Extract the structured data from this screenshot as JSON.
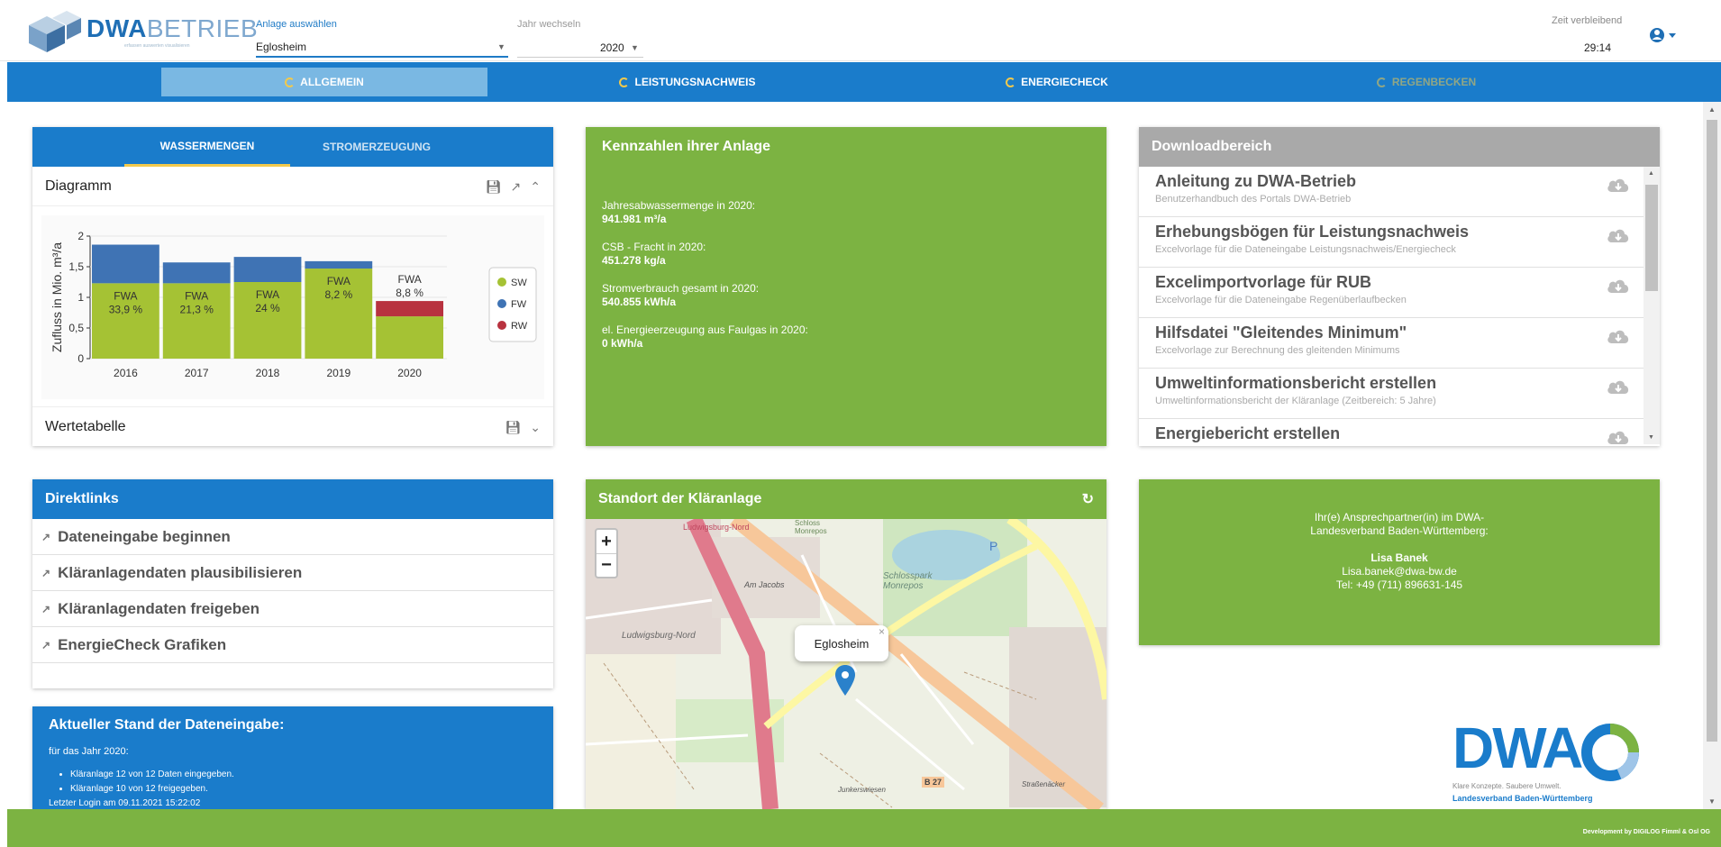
{
  "header": {
    "logo_bold": "DWA",
    "logo_light": "BETRIEB",
    "logo_sub": "erfassen  auswerten  visualisieren",
    "anlage_label": "Anlage auswählen",
    "anlage_value": "Eglosheim",
    "jahr_label": "Jahr wechseln",
    "jahr_value": "2020",
    "zeit_label": "Zeit verbleibend",
    "zeit_value": "29:14"
  },
  "nav": [
    {
      "label": "ALLGEMEIN",
      "state": "active"
    },
    {
      "label": "LEISTUNGSNACHWEIS",
      "state": "normal"
    },
    {
      "label": "ENERGIECHECK",
      "state": "normal"
    },
    {
      "label": "REGENBECKEN",
      "state": "disabled"
    }
  ],
  "wasser": {
    "tab1": "WASSERMENGEN",
    "tab2": "STROMERZEUGUNG",
    "diagramm_title": "Diagramm",
    "werte_title": "Wertetabelle"
  },
  "chart_data": {
    "type": "bar",
    "stacked": true,
    "categories": [
      "2016",
      "2017",
      "2018",
      "2019",
      "2020"
    ],
    "ylabel": "Zufluss in Mio. m³/a",
    "ylim": [
      0,
      2
    ],
    "yticks": [
      "0",
      "0,5",
      "1",
      "1,5",
      "2"
    ],
    "series": [
      {
        "name": "SW",
        "color": "#a5c234",
        "values": [
          1.23,
          1.23,
          1.25,
          1.47,
          0.69
        ]
      },
      {
        "name": "FW",
        "color": "#3f73b4",
        "values": [
          0.63,
          0.34,
          0.41,
          0.12,
          0.0
        ]
      },
      {
        "name": "RW",
        "color": "#b8323f",
        "values": [
          0.0,
          0.0,
          0.0,
          0.0,
          0.25
        ]
      }
    ],
    "annotations": [
      {
        "line1": "FWA",
        "line2": "33,9 %"
      },
      {
        "line1": "FWA",
        "line2": "21,3 %"
      },
      {
        "line1": "FWA",
        "line2": "24 %"
      },
      {
        "line1": "FWA",
        "line2": "8,2 %"
      },
      {
        "line1": "FWA",
        "line2": "8,8 %"
      }
    ],
    "legend_position": "right"
  },
  "kennzahlen": {
    "title": "Kennzahlen ihrer Anlage",
    "items": [
      {
        "label": "Jahresabwassermenge in 2020:",
        "value": "941.981 m³/a"
      },
      {
        "label": "CSB - Fracht in 2020:",
        "value": "451.278 kg/a"
      },
      {
        "label": "Stromverbrauch gesamt in 2020:",
        "value": "540.855 kWh/a"
      },
      {
        "label": "el. Energieerzeugung aus Faulgas in 2020:",
        "value": "0 kWh/a"
      }
    ]
  },
  "downloads": {
    "title": "Downloadbereich",
    "items": [
      {
        "title": "Anleitung zu DWA-Betrieb",
        "sub": "Benutzerhandbuch des Portals DWA-Betrieb"
      },
      {
        "title": "Erhebungsbögen für Leistungsnachweis",
        "sub": "Excelvorlage für die Dateneingabe Leistungsnachweis/Energiecheck"
      },
      {
        "title": "Excelimportvorlage für RUB",
        "sub": "Excelvorlage für die Dateneingabe Regenüberlaufbecken"
      },
      {
        "title": "Hilfsdatei \"Gleitendes Minimum\"",
        "sub": "Excelvorlage zur Berechnung des gleitenden Minimums"
      },
      {
        "title": "Umweltinformationsbericht erstellen",
        "sub": "Umweltinformationsbericht der Kläranlage (Zeitbereich: 5 Jahre)"
      },
      {
        "title": "Energiebericht erstellen",
        "sub": ""
      }
    ]
  },
  "direktlinks": {
    "title": "Direktlinks",
    "items": [
      "Dateneingabe beginnen",
      "Kläranlagendaten plausibilisieren",
      "Kläranlagendaten freigeben",
      "EnergieCheck Grafiken"
    ]
  },
  "stand": {
    "title": "Aktueller Stand der Dateneingabe:",
    "jahr": "für das Jahr 2020:",
    "items": [
      "Kläranlage 12 von 12 Daten eingegeben.",
      "Kläranlage 10 von 12 freigegeben."
    ],
    "last_login": "Letzter Login am 09.11.2021 15:22:02"
  },
  "standort": {
    "title": "Standort der Kläranlage",
    "popup": "Eglosheim",
    "zoom_in": "+",
    "zoom_out": "−",
    "labels": [
      "Ludwigsburg-Nord",
      "Schloss Monrepos",
      "Schlosspark Monrepos",
      "Am Jacobs",
      "P",
      "B 27",
      "Junkerswiesen",
      "Straßenäcker"
    ]
  },
  "kontakt": {
    "line1": "Ihr(e) Ansprechpartner(in) im DWA-",
    "line2": "Landesverband Baden-Württemberg:",
    "name": "Lisa Banek",
    "email": "Lisa.banek@dwa-bw.de",
    "tel": "Tel: +49 (711) 896631-145"
  },
  "dwa_logo": {
    "text": "DWA",
    "slogan": "Klare Konzepte. Saubere Umwelt.",
    "verband": "Landesverband Baden-Württemberg"
  },
  "footer": {
    "text": "Development by DIGILOG Fimml & Osl OG"
  },
  "colors": {
    "blue": "#1a7ccb",
    "green": "#7cb342",
    "grey": "#a9a9a9"
  }
}
